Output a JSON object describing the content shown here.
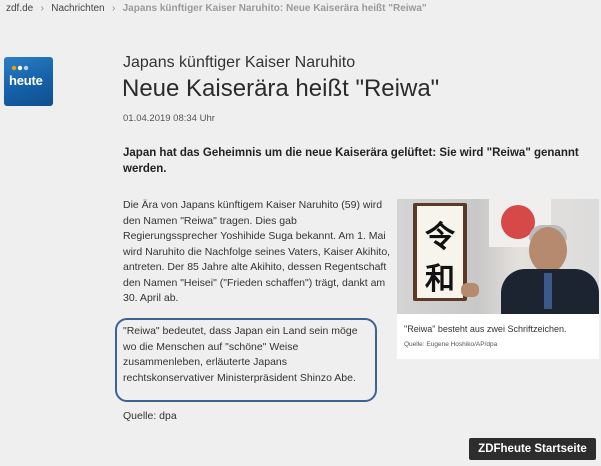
{
  "breadcrumb": {
    "items": [
      "zdf.de",
      "Nachrichten",
      "Japans künftiger Kaiser Naruhito: Neue Kaiserära heißt \"Reiwa\""
    ]
  },
  "logo": {
    "text": "heute",
    "icon": "zdf-heute-logo"
  },
  "article": {
    "kicker": "Japans künftiger Kaiser Naruhito",
    "headline": "Neue Kaiserära heißt \"Reiwa\"",
    "date": "01.04.2019 08:34 Uhr",
    "lead": "Japan hat das Geheimnis um die neue Kaiserära gelüftet: Sie wird \"Reiwa\" genannt werden.",
    "body": "Die Ära von Japans künftigem Kaiser Naruhito (59) wird den Namen \"Reiwa\" tragen. Dies gab Regierungssprecher Yoshihide Suga bekannt. Am 1. Mai wird Naruhito die Nachfolge seines Vaters, Kaiser Akihito, antreten. Der 85 Jahre alte Akihito, dessen Regentschaft den Namen \"Heisei\" (\"Frieden schaffen\") trägt, dankt am 30. April ab.",
    "highlight": "\"Reiwa\" bedeutet, dass Japan ein Land sein möge wo die Menschen auf \"schöne\" Weise zusammenleben, erläuterte Japans rechtskonservativer Ministerpräsident Shinzo Abe.",
    "source": "Quelle: dpa"
  },
  "figure": {
    "sign_chars": [
      "令",
      "和"
    ],
    "caption": "\"Reiwa\" besteht aus zwei Schriftzeichen.",
    "credit": "Quelle: Eugene Hoshiko/AP/dpa"
  },
  "footer": {
    "start_button": "ZDFheute Startseite"
  },
  "colors": {
    "background": "#efefef",
    "highlight_border": "#3c6391",
    "button": "#2d2d2d",
    "logo": "#1660a8"
  }
}
